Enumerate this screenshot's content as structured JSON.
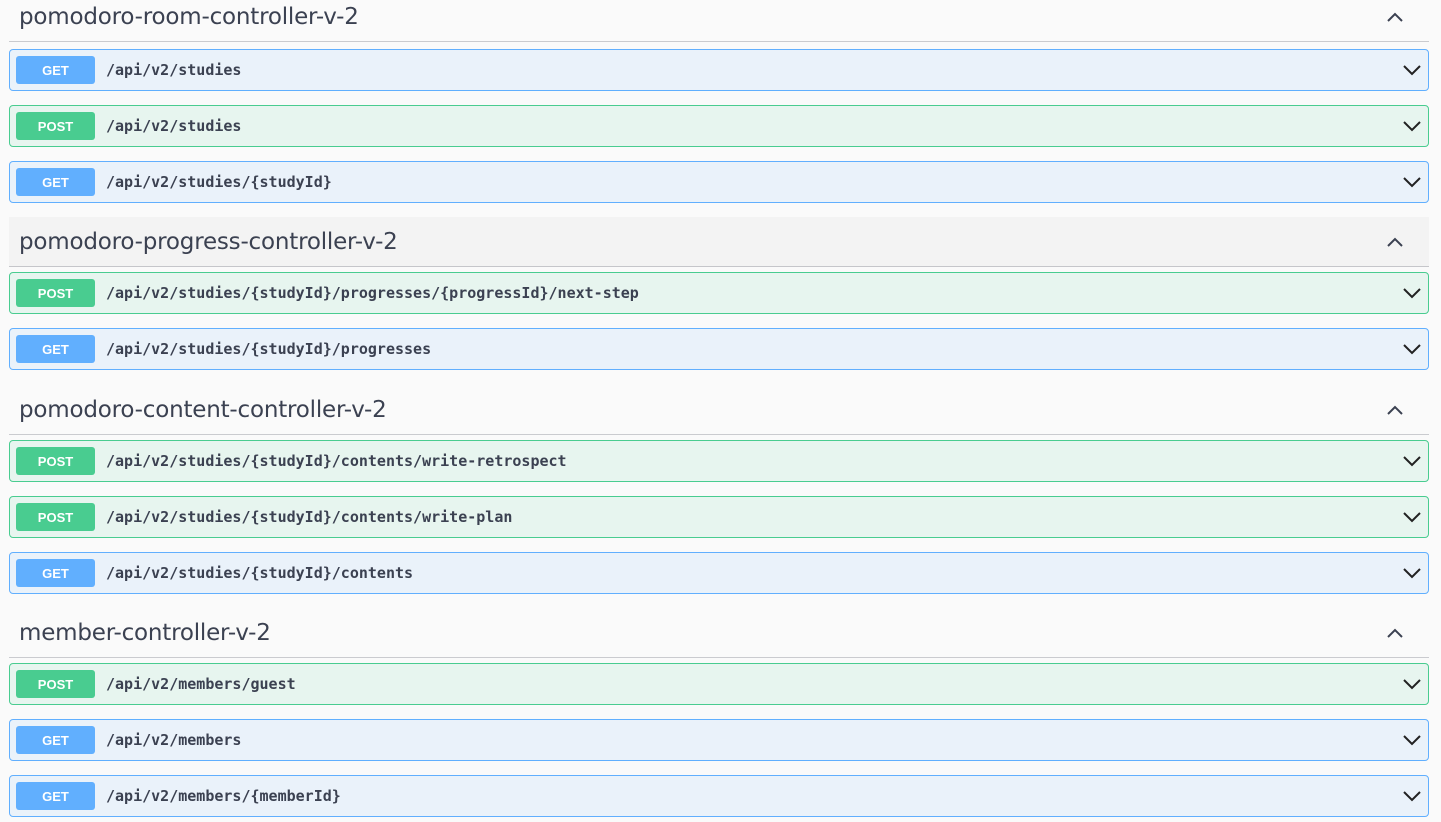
{
  "groups": [
    {
      "name": "pomodoro-room-controller-v-2",
      "operations": [
        {
          "method": "GET",
          "path": "/api/v2/studies"
        },
        {
          "method": "POST",
          "path": "/api/v2/studies"
        },
        {
          "method": "GET",
          "path": "/api/v2/studies/{studyId}"
        }
      ]
    },
    {
      "name": "pomodoro-progress-controller-v-2",
      "operations": [
        {
          "method": "POST",
          "path": "/api/v2/studies/{studyId}/progresses/{progressId}/next-step"
        },
        {
          "method": "GET",
          "path": "/api/v2/studies/{studyId}/progresses"
        }
      ]
    },
    {
      "name": "pomodoro-content-controller-v-2",
      "operations": [
        {
          "method": "POST",
          "path": "/api/v2/studies/{studyId}/contents/write-retrospect"
        },
        {
          "method": "POST",
          "path": "/api/v2/studies/{studyId}/contents/write-plan"
        },
        {
          "method": "GET",
          "path": "/api/v2/studies/{studyId}/contents"
        }
      ]
    },
    {
      "name": "member-controller-v-2",
      "operations": [
        {
          "method": "POST",
          "path": "/api/v2/members/guest"
        },
        {
          "method": "GET",
          "path": "/api/v2/members"
        },
        {
          "method": "GET",
          "path": "/api/v2/members/{memberId}"
        }
      ]
    }
  ],
  "icons": {
    "tag_toggle": "chevron-up-icon",
    "operation_toggle": "chevron-down-icon"
  },
  "colors": {
    "get": "#61affe",
    "post": "#49cc90",
    "text": "#3b4151"
  }
}
